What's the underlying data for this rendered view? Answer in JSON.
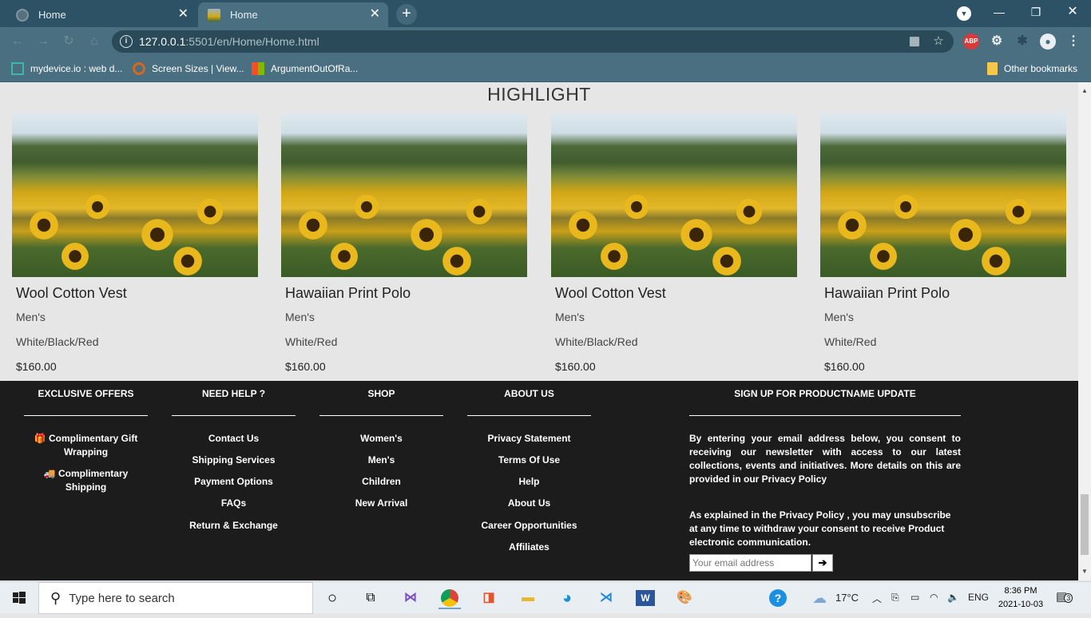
{
  "browser": {
    "tabs": [
      {
        "title": "Home",
        "active": false
      },
      {
        "title": "Home",
        "active": true
      }
    ],
    "new_tab_label": "+",
    "url": {
      "host": "127.0.0.1",
      "rest": ":5501/en/Home/Home.html"
    },
    "bookmarks": [
      {
        "label": "mydevice.io : web d..."
      },
      {
        "label": "Screen Sizes | View..."
      },
      {
        "label": "ArgumentOutOfRa..."
      }
    ],
    "other_bookmarks": "Other bookmarks",
    "abp_label": "ABP"
  },
  "page": {
    "highlight_title": "HIGHLIGHT",
    "products": [
      {
        "name": "Wool Cotton Vest",
        "category": "Men's",
        "color": "White/Black/Red",
        "price": "$160.00"
      },
      {
        "name": "Hawaiian Print Polo",
        "category": "Men's",
        "color": "White/Red",
        "price": "$160.00"
      },
      {
        "name": "Wool Cotton Vest",
        "category": "Men's",
        "color": "White/Black/Red",
        "price": "$160.00"
      },
      {
        "name": "Hawaiian Print Polo",
        "category": "Men's",
        "color": "White/Red",
        "price": "$160.00"
      }
    ]
  },
  "footer": {
    "exclusive": {
      "heading": "EXCLUSIVE OFFERS",
      "items": [
        "🎁 Complimentary Gift Wrapping",
        "🚚 Complimentary Shipping"
      ]
    },
    "help": {
      "heading": "NEED HELP ?",
      "items": [
        "Contact Us",
        "Shipping Services",
        "Payment Options",
        "FAQs",
        "Return & Exchange"
      ]
    },
    "shop": {
      "heading": "SHOP",
      "items": [
        "Women's",
        "Men's",
        "Children",
        "New Arrival"
      ]
    },
    "about": {
      "heading": "ABOUT US",
      "items": [
        "Privacy Statement",
        "Terms Of Use",
        "Help",
        "About Us",
        "Career Opportunities",
        "Affiliates"
      ]
    },
    "signup": {
      "heading": "SIGN UP FOR PRODUCTNAME UPDATE",
      "text": "By entering your email address below, you consent to receiving our newsletter with access to our latest collections, events and initiatives. More details on this are provided in our Privacy Policy",
      "text2": "As explained in the Privacy Policy , you may unsubscribe at any time to withdraw your consent to receive Product electronic communication.",
      "email_placeholder": "Your email address",
      "submit_label": "➔"
    }
  },
  "taskbar": {
    "search_placeholder": "Type here to search",
    "weather": "17°C",
    "language": "ENG",
    "time": "8:36 PM",
    "date": "2021-10-03",
    "notification_count": "3"
  }
}
